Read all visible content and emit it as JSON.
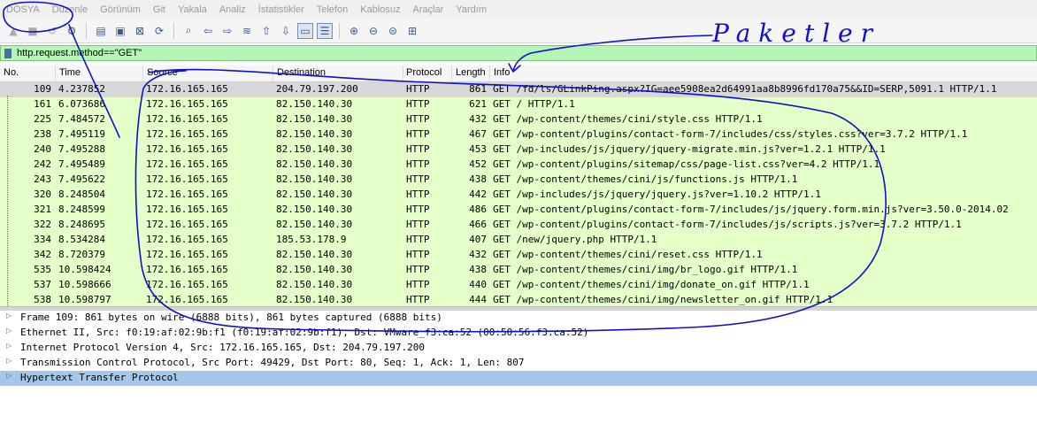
{
  "menu": [
    "DOSYA",
    "Düzenle",
    "Görünüm",
    "Git",
    "Yakala",
    "Analiz",
    "İstatistikler",
    "Telefon",
    "Kablosuz",
    "Araçlar",
    "Yardım"
  ],
  "filter": {
    "value": "http.request.method==\"GET\""
  },
  "columns": {
    "no": "No.",
    "time": "Time",
    "source": "Source",
    "destination": "Destination",
    "protocol": "Protocol",
    "length": "Length",
    "info": "Info"
  },
  "packets": [
    {
      "no": "109",
      "time": "4.237852",
      "src": "172.16.165.165",
      "dst": "204.79.197.200",
      "proto": "HTTP",
      "len": "861",
      "info": "GET /fd/ls/GLinkPing.aspx?IG=aee5908ea2d64991aa8b8996fd170a75&&ID=SERP,5091.1 HTTP/1.1"
    },
    {
      "no": "161",
      "time": "6.073686",
      "src": "172.16.165.165",
      "dst": "82.150.140.30",
      "proto": "HTTP",
      "len": "621",
      "info": "GET / HTTP/1.1"
    },
    {
      "no": "225",
      "time": "7.484572",
      "src": "172.16.165.165",
      "dst": "82.150.140.30",
      "proto": "HTTP",
      "len": "432",
      "info": "GET /wp-content/themes/cini/style.css HTTP/1.1"
    },
    {
      "no": "238",
      "time": "7.495119",
      "src": "172.16.165.165",
      "dst": "82.150.140.30",
      "proto": "HTTP",
      "len": "467",
      "info": "GET /wp-content/plugins/contact-form-7/includes/css/styles.css?ver=3.7.2 HTTP/1.1"
    },
    {
      "no": "240",
      "time": "7.495288",
      "src": "172.16.165.165",
      "dst": "82.150.140.30",
      "proto": "HTTP",
      "len": "453",
      "info": "GET /wp-includes/js/jquery/jquery-migrate.min.js?ver=1.2.1 HTTP/1.1"
    },
    {
      "no": "242",
      "time": "7.495489",
      "src": "172.16.165.165",
      "dst": "82.150.140.30",
      "proto": "HTTP",
      "len": "452",
      "info": "GET /wp-content/plugins/sitemap/css/page-list.css?ver=4.2 HTTP/1.1"
    },
    {
      "no": "243",
      "time": "7.495622",
      "src": "172.16.165.165",
      "dst": "82.150.140.30",
      "proto": "HTTP",
      "len": "438",
      "info": "GET /wp-content/themes/cini/js/functions.js HTTP/1.1"
    },
    {
      "no": "320",
      "time": "8.248504",
      "src": "172.16.165.165",
      "dst": "82.150.140.30",
      "proto": "HTTP",
      "len": "442",
      "info": "GET /wp-includes/js/jquery/jquery.js?ver=1.10.2 HTTP/1.1"
    },
    {
      "no": "321",
      "time": "8.248599",
      "src": "172.16.165.165",
      "dst": "82.150.140.30",
      "proto": "HTTP",
      "len": "486",
      "info": "GET /wp-content/plugins/contact-form-7/includes/js/jquery.form.min.js?ver=3.50.0-2014.02"
    },
    {
      "no": "322",
      "time": "8.248695",
      "src": "172.16.165.165",
      "dst": "82.150.140.30",
      "proto": "HTTP",
      "len": "466",
      "info": "GET /wp-content/plugins/contact-form-7/includes/js/scripts.js?ver=3.7.2 HTTP/1.1"
    },
    {
      "no": "334",
      "time": "8.534284",
      "src": "172.16.165.165",
      "dst": "185.53.178.9",
      "proto": "HTTP",
      "len": "407",
      "info": "GET /new/jquery.php HTTP/1.1"
    },
    {
      "no": "342",
      "time": "8.720379",
      "src": "172.16.165.165",
      "dst": "82.150.140.30",
      "proto": "HTTP",
      "len": "432",
      "info": "GET /wp-content/themes/cini/reset.css HTTP/1.1"
    },
    {
      "no": "535",
      "time": "10.598424",
      "src": "172.16.165.165",
      "dst": "82.150.140.30",
      "proto": "HTTP",
      "len": "438",
      "info": "GET /wp-content/themes/cini/img/br_logo.gif HTTP/1.1"
    },
    {
      "no": "537",
      "time": "10.598666",
      "src": "172.16.165.165",
      "dst": "82.150.140.30",
      "proto": "HTTP",
      "len": "440",
      "info": "GET /wp-content/themes/cini/img/donate_on.gif HTTP/1.1"
    },
    {
      "no": "538",
      "time": "10.598797",
      "src": "172.16.165.165",
      "dst": "82.150.140.30",
      "proto": "HTTP",
      "len": "444",
      "info": "GET /wp-content/themes/cini/img/newsletter_on.gif HTTP/1.1"
    }
  ],
  "details": [
    "Frame 109: 861 bytes on wire (6888 bits), 861 bytes captured (6888 bits)",
    "Ethernet II, Src: f0:19:af:02:9b:f1 (f0:19:af:02:9b:f1), Dst: VMware_f3:ca:52 (00:50:56:f3:ca:52)",
    "Internet Protocol Version 4, Src: 172.16.165.165, Dst: 204.79.197.200",
    "Transmission Control Protocol, Src Port: 49429, Dst Port: 80, Seq: 1, Ack: 1, Len: 807",
    "Hypertext Transfer Protocol"
  ],
  "annotation_text": "Paketler",
  "toolbar_icons": [
    "shark-fin-start-icon",
    "stop-icon",
    "restart-icon",
    "options-gear-icon",
    "open-folder-icon",
    "save-icon",
    "close-file-icon",
    "reload-icon",
    "find-icon",
    "back-arrow-icon",
    "forward-arrow-icon",
    "go-to-packet-icon",
    "first-packet-icon",
    "last-packet-icon",
    "autoscroll-icon",
    "colorize-icon",
    "zoom-in-icon",
    "zoom-out-icon",
    "zoom-normal-icon",
    "resize-columns-icon"
  ],
  "colors": {
    "filter_bg": "#b5f5b5",
    "http_row_bg": "#e4ffc7",
    "selected_detail": "#a4c8ec",
    "annotation_ink": "#1010cc"
  }
}
